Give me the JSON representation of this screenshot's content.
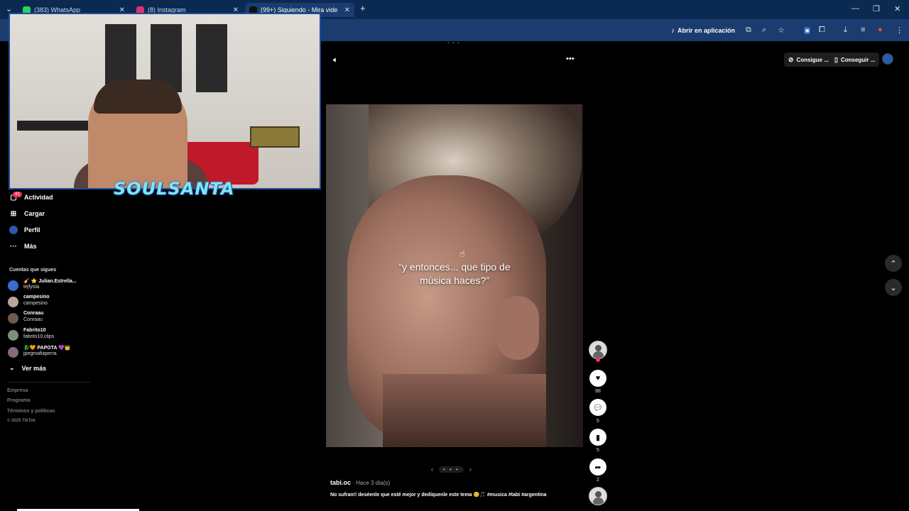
{
  "tabs": [
    {
      "label": "(383) WhatsApp",
      "icon": "whatsapp-icon",
      "color": "#25d366"
    },
    {
      "label": "(8) Instagram",
      "icon": "instagram-icon",
      "color": "#e1306c"
    },
    {
      "label": "(99+) Siguiendo - Mira vide",
      "icon": "tiktok-icon",
      "color": "#111111"
    }
  ],
  "toolbar": {
    "open_app": "Abrir en aplicación"
  },
  "webcam": {
    "logo_text": "SOULSANTA"
  },
  "sidebar": {
    "nav": [
      {
        "label": "Actividad",
        "icon": "inbox-icon"
      },
      {
        "label": "Cargar",
        "icon": "upload-icon"
      },
      {
        "label": "Perfil",
        "icon": "profile-icon"
      },
      {
        "label": "Más",
        "icon": "more-icon"
      }
    ],
    "activity_badge": "41",
    "following_title": "Cuentas que sigues",
    "accounts": [
      {
        "name": "🎸 ⭐ Julian.Estrella...",
        "handle": "tejfysta"
      },
      {
        "name": "campesino",
        "handle": "campesino"
      },
      {
        "name": "Conraau",
        "handle": "Conraau"
      },
      {
        "name": "Fabrito10",
        "handle": "fabrito10.clips"
      },
      {
        "name": "🐉🧡 PAPOTA 💜👑",
        "handle": "jpegmafiaperra"
      }
    ],
    "see_more": "Ver más",
    "footer": [
      "Empresa",
      "Programa",
      "Términos y políticas",
      "© 2025 TikTok"
    ]
  },
  "header_right": {
    "pill1": "Consigue ...",
    "pill2": "Conseguir ..."
  },
  "video": {
    "caption_line1": "“y entonces... que tipo de",
    "caption_line2": "música haces?”"
  },
  "actions": {
    "likes": "88",
    "comments": "5",
    "saves": "5",
    "shares": "2"
  },
  "post": {
    "author": "tabi.oc",
    "time": " · Hace 3 día(s)",
    "description": "No sufran!! deséenle que esté mejor y dedíquenle este tema 😊🎵 #musica #tabi #argentina",
    "carousel_page": "• • •"
  }
}
